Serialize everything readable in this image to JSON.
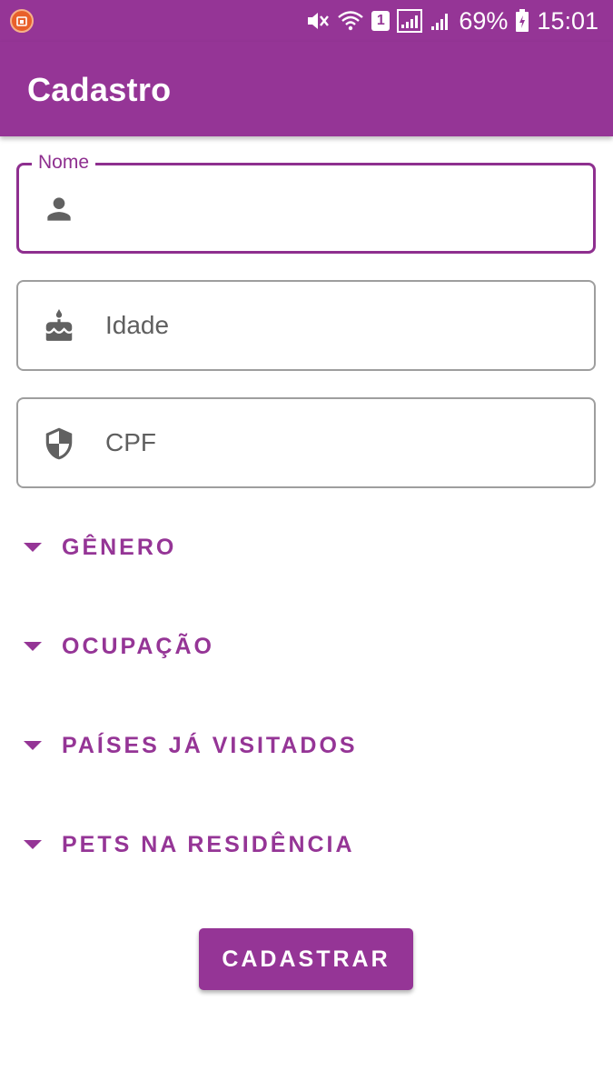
{
  "status_bar": {
    "battery": "69%",
    "time": "15:01",
    "sim_number": "1",
    "icons": [
      "app-notification-icon",
      "mute-icon",
      "wifi-icon",
      "sim-icon",
      "signal-icon",
      "signal-icon",
      "battery-icon"
    ]
  },
  "app_bar": {
    "title": "Cadastro"
  },
  "form": {
    "nome": {
      "label": "Nome",
      "value": "",
      "icon": "person-icon"
    },
    "idade": {
      "placeholder": "Idade",
      "icon": "cake-icon"
    },
    "cpf": {
      "placeholder": "CPF",
      "icon": "shield-icon"
    }
  },
  "dropdowns": [
    {
      "label": "GÊNERO"
    },
    {
      "label": "OCUPAÇÃO"
    },
    {
      "label": "PAÍSES JÁ VISITADOS"
    },
    {
      "label": "PETS NA RESIDÊNCIA"
    }
  ],
  "submit": {
    "label": "CADASTRAR"
  },
  "colors": {
    "primary": "#953596",
    "focused_border": "#8e2f8f",
    "outline": "#9e9e9e",
    "icon_gray": "#616161"
  }
}
